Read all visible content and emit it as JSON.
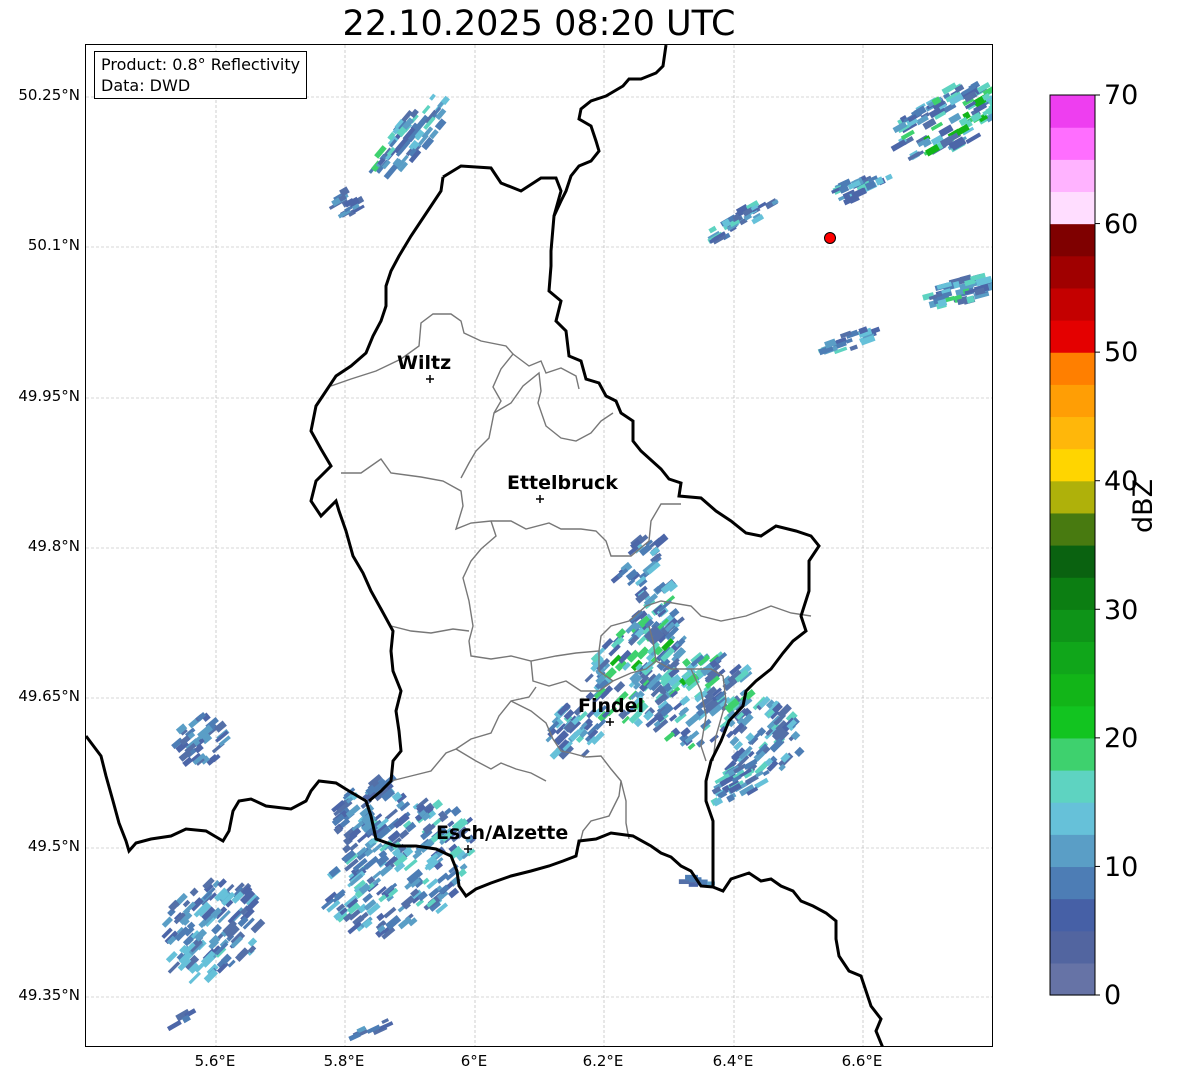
{
  "title": "22.10.2025 08:20 UTC",
  "info": {
    "product": "Product: 0.8° Reflectivity",
    "data": "Data: DWD"
  },
  "lat_ticks": [
    "50.25°N",
    "50.1°N",
    "49.95°N",
    "49.8°N",
    "49.65°N",
    "49.5°N",
    "49.35°N"
  ],
  "lon_ticks": [
    "5.6°E",
    "5.8°E",
    "6°E",
    "6.2°E",
    "6.4°E",
    "6.6°E"
  ],
  "cities": [
    {
      "name": "Wiltz"
    },
    {
      "name": "Ettelbruck"
    },
    {
      "name": "Findel"
    },
    {
      "name": "Esch/Alzette"
    }
  ],
  "colorbar": {
    "unit": "dBZ",
    "ticks": [
      "0",
      "10",
      "20",
      "30",
      "40",
      "50",
      "60",
      "70"
    ],
    "colors": [
      "#6673a6",
      "#5265a0",
      "#4660a6",
      "#4d7db5",
      "#5a9ec6",
      "#66c1d9",
      "#5ed3c1",
      "#3ed16e",
      "#12c420",
      "#12b518",
      "#10a61a",
      "#0e9418",
      "#0c7e12",
      "#0a6210",
      "#487a10",
      "#afb10a",
      "#ffd500",
      "#ffb70a",
      "#ff9e05",
      "#ff7f00",
      "#e40000",
      "#c40000",
      "#a00000",
      "#7f0000",
      "#ffddff",
      "#ffb3ff",
      "#ff6eff",
      "#ee3ef0"
    ]
  },
  "radar_site": {
    "color": "#ff0000"
  }
}
